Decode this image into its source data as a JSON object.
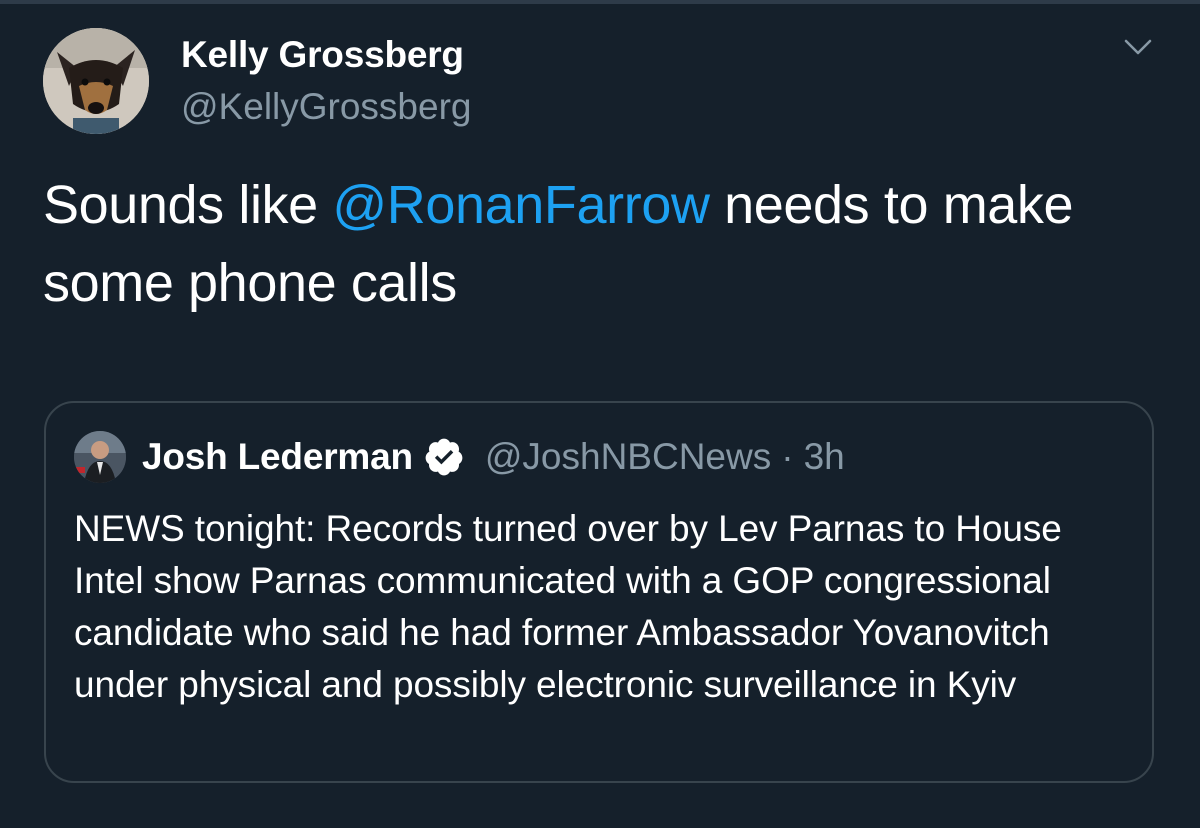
{
  "tweet": {
    "author_name": "Kelly Grossberg",
    "author_handle": "@KellyGrossberg",
    "text_before": "Sounds like ",
    "mention": "@RonanFarrow",
    "text_after": " needs to make some phone calls",
    "menu_icon": "chevron-down-icon"
  },
  "quoted": {
    "author_name": "Josh Lederman",
    "verified_icon": "verified-badge-icon",
    "handle": "@JoshNBCNews",
    "separator": "·",
    "time": "3h",
    "text": "NEWS tonight: Records turned over by Lev Parnas to House Intel show Parnas communicated with a GOP congressional candidate who said he had former Ambassador Yovanovitch under physical and possibly electronic surveillance in Kyiv"
  },
  "colors": {
    "background": "#15202b",
    "mention": "#1da1f2",
    "secondary_text": "#8899a6",
    "border": "#38444d"
  }
}
